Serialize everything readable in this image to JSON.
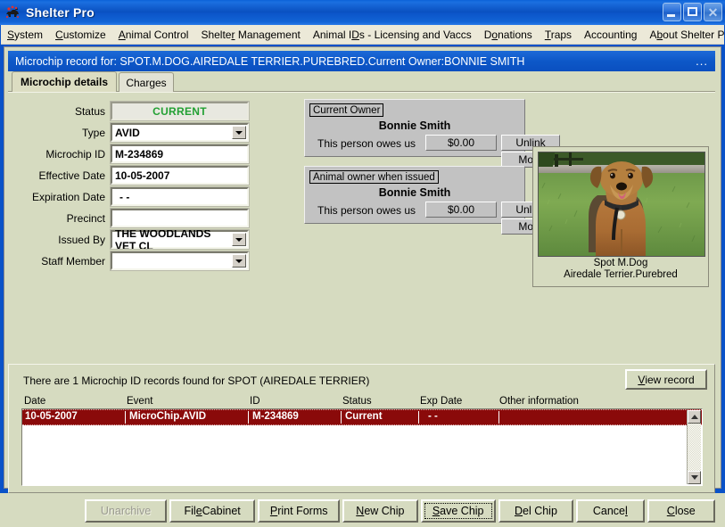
{
  "window": {
    "title": "Shelter Pro",
    "icon": "dog-icon",
    "controls": {
      "minimize": "minimize",
      "maximize": "maximize",
      "close": "close"
    }
  },
  "menubar": {
    "items": [
      {
        "label": "System",
        "accel": "S"
      },
      {
        "label": "Customize",
        "accel": "C"
      },
      {
        "label": "Animal Control",
        "accel": "A"
      },
      {
        "label": "Shelter Management",
        "accel": "r"
      },
      {
        "label": "Animal IDs - Licensing and Vaccs",
        "accel": "D"
      },
      {
        "label": "Donations",
        "accel": "o"
      },
      {
        "label": "Traps",
        "accel": "T"
      },
      {
        "label": "Accounting",
        "accel": "g"
      },
      {
        "label": "About Shelter Pro",
        "accel": "b"
      }
    ]
  },
  "dialog": {
    "header": "Microchip record for: SPOT.M.DOG.AIREDALE TERRIER.PUREBRED.Current Owner:BONNIE SMITH",
    "header_overflow": "..."
  },
  "tabs": [
    {
      "label": "Microchip details",
      "active": true
    },
    {
      "label": "Charges",
      "active": false
    }
  ],
  "form": {
    "fields": [
      {
        "label": "Status",
        "value": "CURRENT",
        "type": "readonly"
      },
      {
        "label": "Type",
        "value": "AVID",
        "type": "combo"
      },
      {
        "label": "Microchip ID",
        "value": "M-234869",
        "type": "text"
      },
      {
        "label": "Effective Date",
        "value": "10-05-2007",
        "type": "text"
      },
      {
        "label": "Expiration Date",
        "value": "-  -",
        "type": "text"
      },
      {
        "label": "Precinct",
        "value": "",
        "type": "text"
      },
      {
        "label": "Issued By",
        "value": "THE WOODLANDS VET CL",
        "type": "combo"
      },
      {
        "label": "Staff Member",
        "value": "",
        "type": "combo"
      }
    ]
  },
  "owner_panels": [
    {
      "legend": "Current Owner",
      "name": "Bonnie Smith",
      "owes_label": "This person owes us",
      "owes_amount": "$0.00",
      "unlink_label": "Unlink",
      "more_label": "More"
    },
    {
      "legend": "Animal owner when issued",
      "name": "Bonnie Smith",
      "owes_label": "This person owes us",
      "owes_amount": "$0.00",
      "unlink_label": "Unlink",
      "more_label": "More"
    }
  ],
  "photo": {
    "caption_line1": "Spot  M.Dog",
    "caption_line2": "Airedale Terrier.Purebred",
    "alt": "airedale-terrier-photo"
  },
  "records": {
    "message": "There are 1 Microchip ID records found for SPOT (AIREDALE TERRIER)",
    "view_record_label": "View record",
    "view_record_accel": "V",
    "columns": [
      "Date",
      "Event",
      "ID",
      "Status",
      "Exp Date",
      "Other information"
    ],
    "rows": [
      {
        "date": "10-05-2007",
        "event": "MicroChip.AVID",
        "id": "M-234869",
        "status": "Current",
        "exp_date": "-  -",
        "other": "",
        "selected": true
      }
    ]
  },
  "buttons": [
    {
      "label": "Unarchive",
      "accel": "",
      "state": "disabled"
    },
    {
      "label": "File Cabinet",
      "accel": "e",
      "state": "normal"
    },
    {
      "label": "Print Forms",
      "accel": "P",
      "state": "normal"
    },
    {
      "label": "New Chip",
      "accel": "N",
      "state": "normal"
    },
    {
      "label": "Save Chip",
      "accel": "S",
      "state": "focused"
    },
    {
      "label": "Del Chip",
      "accel": "D",
      "state": "normal"
    },
    {
      "label": "Cancel",
      "accel": "l",
      "state": "normal"
    },
    {
      "label": "Close",
      "accel": "C",
      "state": "normal"
    }
  ],
  "colors": {
    "form_background": "#d6dbc0",
    "panel_gray": "#c2c2c2",
    "title_blue": "#0a52c8",
    "status_green": "#22a033",
    "selected_row": "#8a0a0a",
    "menubar": "#ece9d8"
  }
}
